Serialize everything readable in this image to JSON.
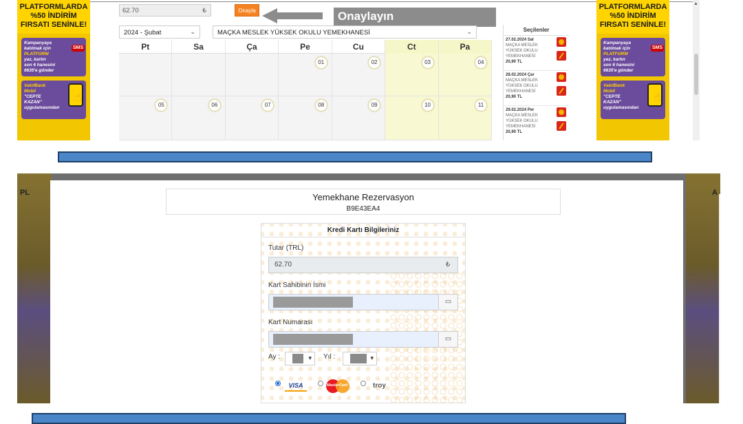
{
  "top": {
    "ad": {
      "headline": [
        "PLATFORMLARDA",
        "%50 İNDİRİM",
        "FIRSATI SENİNLE!"
      ],
      "box1": [
        "Kampanyaya",
        "katılmak için",
        "PLATFORM",
        "yaz, kartın",
        "son 6 hanesini",
        "6635'e gönder"
      ],
      "sms_label": "SMS",
      "box2": [
        "VakıfBank",
        "Mobil",
        "\"CEPTE",
        "KAZAN\"",
        "uygulamasından"
      ]
    },
    "amount_value": "62.70",
    "currency_symbol": "₺",
    "confirm_button": "Onayla",
    "callout_text": "Onaylayın",
    "year_month": "2024 - Şubat",
    "kitchen": "MAÇKA MESLEK YÜKSEK OKULU YEMEKHANESİ",
    "weekdays": [
      "Pt",
      "Sa",
      "Ça",
      "Pe",
      "Cu",
      "Ct",
      "Pa"
    ],
    "days": [
      "",
      "",
      "",
      "01",
      "02",
      "03",
      "04",
      "05",
      "06",
      "07",
      "08",
      "09",
      "10",
      "11"
    ],
    "selected_title": "Seçilenler",
    "selected": [
      {
        "date": "27.02.2024 Sal",
        "place": [
          "MAÇKA MESLEK",
          "YÜKSEK OKULU",
          "YEMEKHANESİ"
        ],
        "price": "20,90 TL"
      },
      {
        "date": "28.02.2024 Çar",
        "place": [
          "MAÇKA MESLEK",
          "YÜKSEK OKULU",
          "YEMEKHANESİ"
        ],
        "price": "20,90 TL"
      },
      {
        "date": "29.02.2024 Per",
        "place": [
          "MAÇKA MESLEK",
          "YÜKSEK OKULU",
          "YEMEKHANESİ"
        ],
        "price": "20,90 TL"
      }
    ]
  },
  "bottom": {
    "title": "Yemekhane Rezervasyon",
    "code": "B9E43EA4",
    "card_title": "Kredi Kartı Bilgileriniz",
    "amount_label": "Tutar (TRL)",
    "amount_value": "62.70",
    "currency_symbol": "₺",
    "holder_label": "Kart Sahibinin İsmi",
    "number_label": "Kart Numarası",
    "card_icon": "▭",
    "month_label": "Ay :",
    "year_label": "Yıl :",
    "visa": "VISA",
    "mastercard": "MasterCard",
    "troy": "troy",
    "side_ad_text": "PL",
    "side_ad_text_r": "A"
  },
  "colors": {
    "accent_orange": "#f58220",
    "bar_blue": "#4a86c8",
    "weekend": "#f8f9d2"
  }
}
